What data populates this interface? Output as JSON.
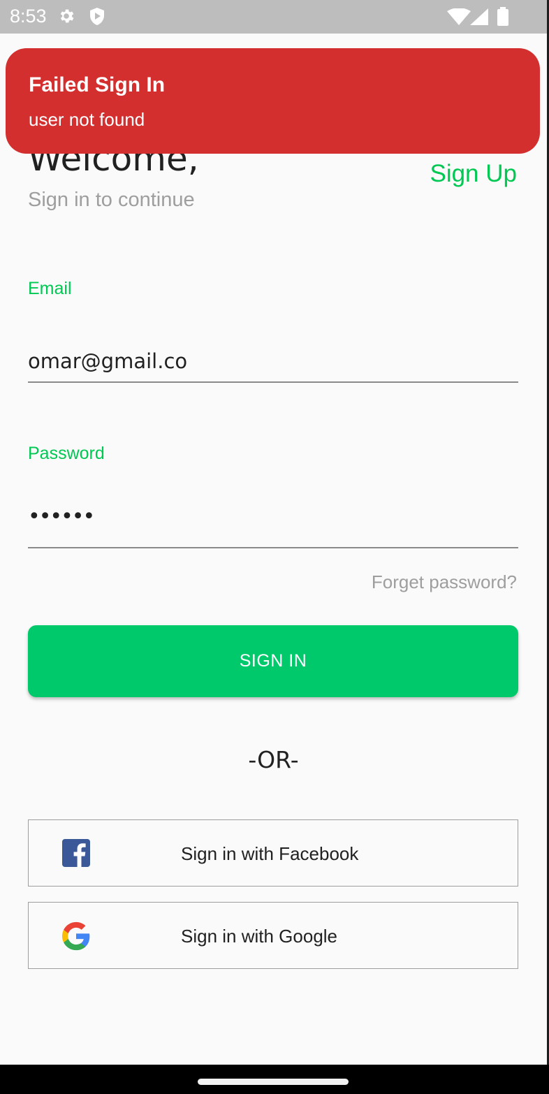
{
  "status_bar": {
    "time": "8:53",
    "icons": [
      "gear-icon",
      "shield-icon",
      "wifi-icon",
      "signal-icon",
      "battery-icon"
    ]
  },
  "toast": {
    "title": "Failed Sign In",
    "message": "user not found",
    "color": "#d32f2f"
  },
  "header": {
    "title": "Welcome,",
    "subtitle": "Sign in to continue",
    "signup_label": "Sign Up"
  },
  "form": {
    "email_label": "Email",
    "email_value": "omar@gmail.co",
    "password_label": "Password",
    "password_value": "••••••",
    "forget_label": "Forget password?",
    "signin_label": "SIGN IN"
  },
  "divider_text": "-OR-",
  "social": {
    "facebook_label": "Sign in with Facebook",
    "google_label": "Sign in with Google"
  },
  "colors": {
    "accent": "#00c853",
    "button": "#00c96b",
    "facebook": "#3b5998"
  }
}
